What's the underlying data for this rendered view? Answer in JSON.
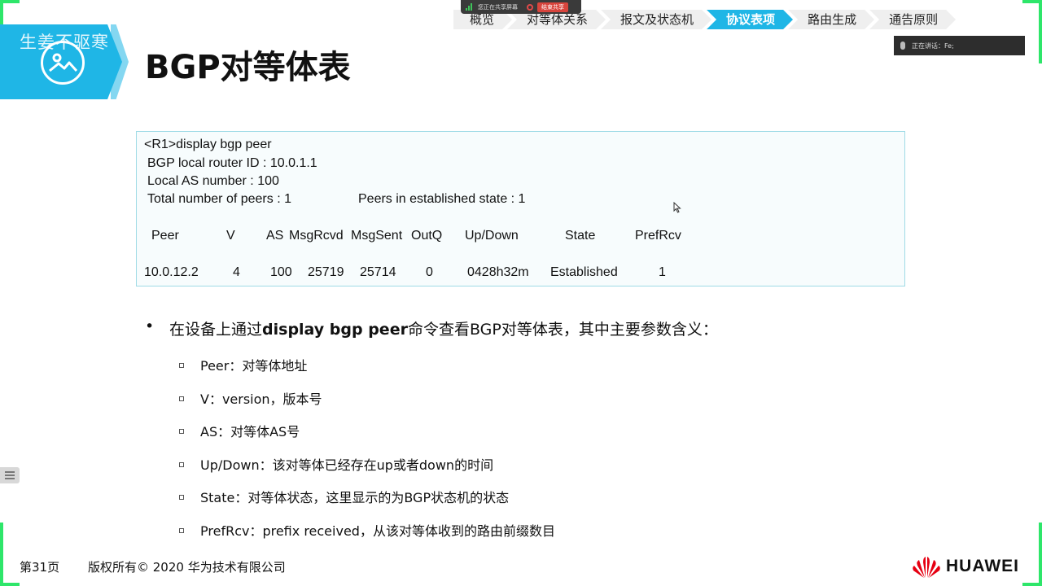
{
  "header": {
    "watermark": "生姜不驱寒",
    "title": "BGP对等体表"
  },
  "nav": {
    "crumbs": [
      "概览",
      "对等体关系",
      "报文及状态机",
      "协议表项",
      "路由生成",
      "通告原则"
    ],
    "active_index": 3
  },
  "share_bar": {
    "status": "您正在共享屏幕",
    "stop_label": "结束共享"
  },
  "speaking": {
    "text": "正在讲话：Fe;"
  },
  "terminal": {
    "command": "<R1>display bgp peer",
    "router_id": "BGP local router ID : 10.0.1.1",
    "local_as": "Local AS number : 100",
    "total_peers": "Total number of peers : 1",
    "established": "Peers in established state : 1",
    "columns": [
      "Peer",
      "V",
      "AS",
      "MsgRcvd",
      "MsgSent",
      "OutQ",
      "Up/Down",
      "State",
      "PrefRcv"
    ],
    "row": [
      "10.0.12.2",
      "4",
      "100",
      "25719",
      "25714",
      "0",
      "0428h32m",
      "Established",
      "1"
    ]
  },
  "bullets": {
    "main_prefix": "在设备上通过",
    "main_bold": "display bgp peer",
    "main_suffix": "命令查看BGP对等体表，其中主要参数含义：",
    "items": [
      "Peer：对等体地址",
      "V：version，版本号",
      "AS：对等体AS号",
      "Up/Down：该对等体已经存在up或者down的时间",
      "State：对等体状态，这里显示的为BGP状态机的状态",
      "PrefRcv：prefix received，从该对等体收到的路由前缀数目"
    ]
  },
  "footer": {
    "page": "第31页",
    "copyright": "版权所有© 2020 华为技术有限公司",
    "brand": "HUAWEI"
  },
  "colors": {
    "accent": "#1fb6e6",
    "frame": "#2ee66a",
    "logo_red": "#e60012"
  }
}
